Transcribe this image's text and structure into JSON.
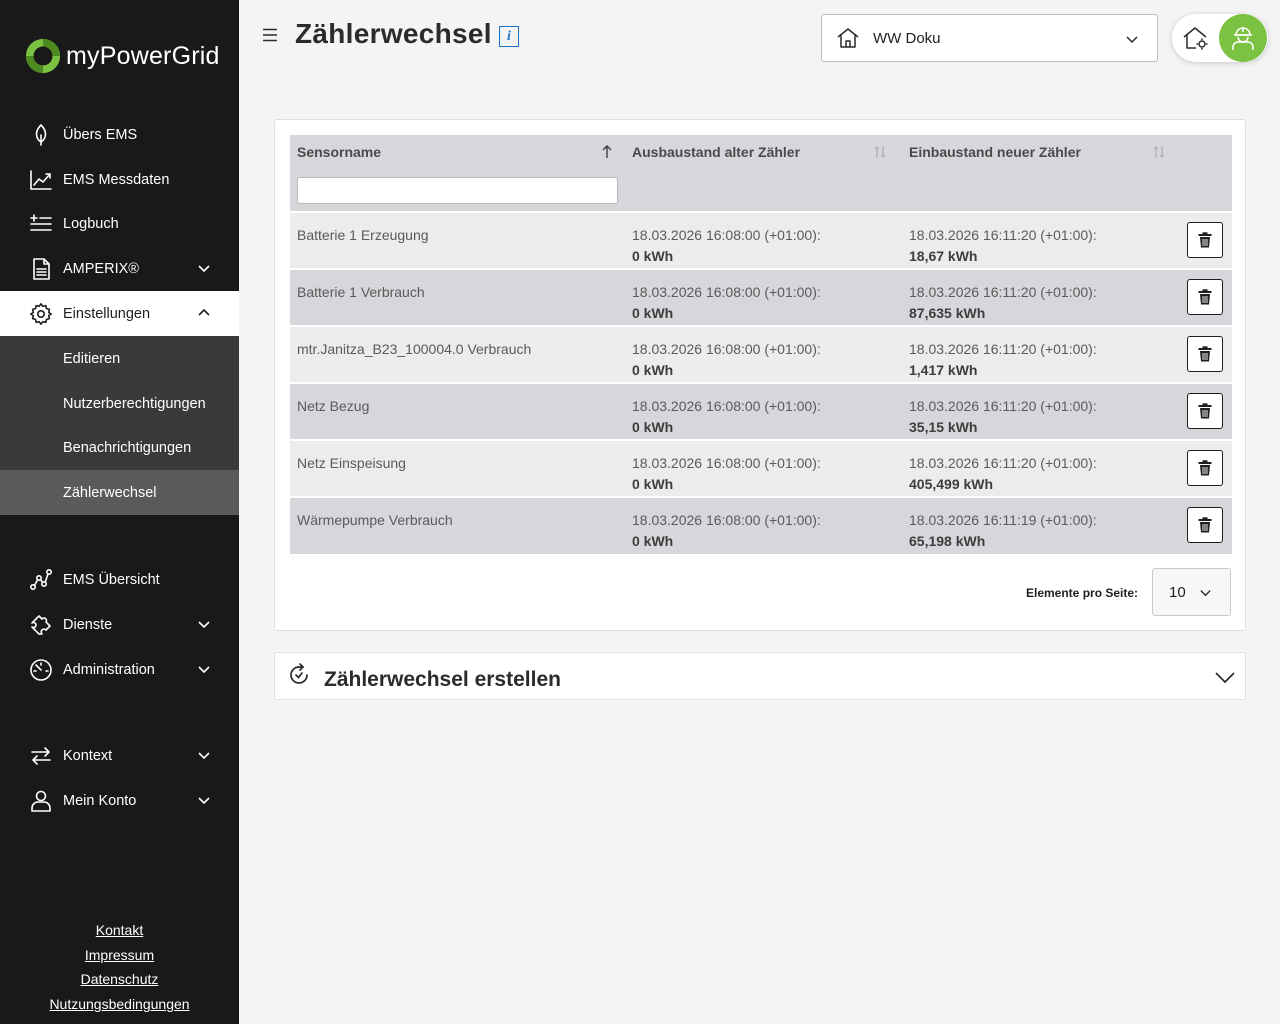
{
  "brand": {
    "name": "myPowerGrid",
    "accent": "#7cc242"
  },
  "nav": {
    "items": [
      {
        "label": "Übers EMS",
        "icon": "leaf-icon"
      },
      {
        "label": "EMS Messdaten",
        "icon": "chart-line-icon"
      },
      {
        "label": "Logbuch",
        "icon": "list-add-icon"
      },
      {
        "label": "AMPERIX®",
        "icon": "document-icon"
      },
      {
        "label": "Einstellungen",
        "icon": "gear-icon"
      }
    ],
    "settings_sub": [
      "Editieren",
      "Nutzerberechtigungen",
      "Benachrichtigungen",
      "Zählerwechsel"
    ],
    "lower": [
      {
        "label": "EMS Übersicht",
        "icon": "network-icon"
      },
      {
        "label": "Dienste",
        "icon": "puzzle-icon"
      },
      {
        "label": "Administration",
        "icon": "speedometer-icon"
      }
    ],
    "context": [
      {
        "label": "Kontext",
        "icon": "arrows-swap-icon"
      },
      {
        "label": "Mein Konto",
        "icon": "user-icon"
      }
    ]
  },
  "footer": [
    "Kontakt",
    "Impressum",
    "Datenschutz",
    "Nutzungsbedingungen"
  ],
  "header": {
    "title": "Zählerwechsel",
    "info": "i",
    "site": "WW Doku"
  },
  "table": {
    "columns": [
      "Sensorname",
      "Ausbaustand alter Zähler",
      "Einbaustand neuer Zähler"
    ],
    "rows": [
      {
        "name": "Batterie 1 Erzeugung",
        "old_date": "18.03.2026 16:08:00 (+01:00):",
        "old_val": "0 kWh",
        "new_date": "18.03.2026 16:11:20 (+01:00):",
        "new_val": "18,67 kWh"
      },
      {
        "name": "Batterie 1 Verbrauch",
        "old_date": "18.03.2026 16:08:00 (+01:00):",
        "old_val": "0 kWh",
        "new_date": "18.03.2026 16:11:20 (+01:00):",
        "new_val": "87,635 kWh"
      },
      {
        "name": "mtr.Janitza_B23_100004.0 Verbrauch",
        "old_date": "18.03.2026 16:08:00 (+01:00):",
        "old_val": "0 kWh",
        "new_date": "18.03.2026 16:11:20 (+01:00):",
        "new_val": "1,417 kWh"
      },
      {
        "name": "Netz Bezug",
        "old_date": "18.03.2026 16:08:00 (+01:00):",
        "old_val": "0 kWh",
        "new_date": "18.03.2026 16:11:20 (+01:00):",
        "new_val": "35,15 kWh"
      },
      {
        "name": "Netz Einspeisung",
        "old_date": "18.03.2026 16:08:00 (+01:00):",
        "old_val": "0 kWh",
        "new_date": "18.03.2026 16:11:20 (+01:00):",
        "new_val": "405,499 kWh"
      },
      {
        "name": "Wärmepumpe Verbrauch",
        "old_date": "18.03.2026 16:08:00 (+01:00):",
        "old_val": "0 kWh",
        "new_date": "18.03.2026 16:11:19 (+01:00):",
        "new_val": "65,198 kWh"
      }
    ]
  },
  "pager": {
    "label": "Elemente pro Seite:",
    "value": "10"
  },
  "create": {
    "title": "Zählerwechsel erstellen"
  }
}
